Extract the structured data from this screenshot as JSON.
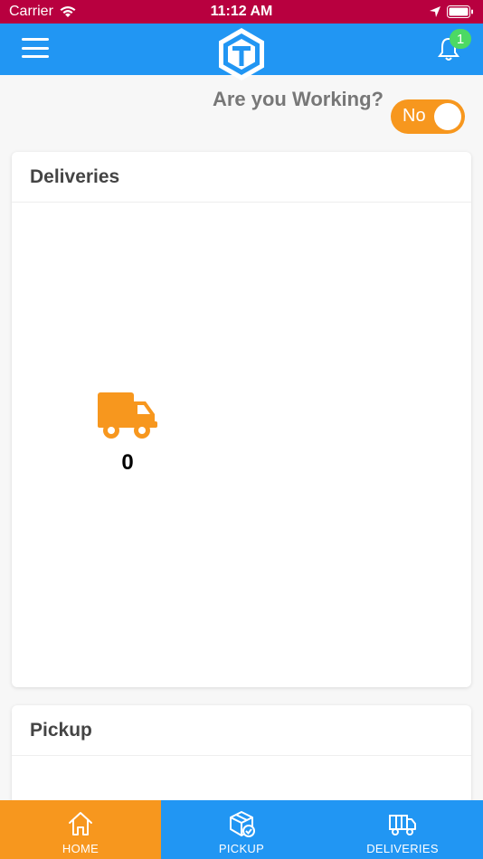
{
  "status_bar": {
    "carrier": "Carrier",
    "time": "11:12 AM"
  },
  "header": {
    "notification_count": "1",
    "brand_color": "#2196f3"
  },
  "working": {
    "label": "Are you Working?",
    "toggle_value": "No",
    "toggle_color": "#f7971e"
  },
  "deliveries_card": {
    "title": "Deliveries",
    "count": "0",
    "icon": "truck-icon"
  },
  "pickup_card": {
    "title": "Pickup"
  },
  "tab_bar": {
    "tabs": [
      {
        "label": "HOME",
        "icon": "home-icon",
        "active": true
      },
      {
        "label": "PICKUP",
        "icon": "package-icon",
        "active": false
      },
      {
        "label": "DELIVERIES",
        "icon": "delivery-truck-icon",
        "active": false
      }
    ]
  }
}
